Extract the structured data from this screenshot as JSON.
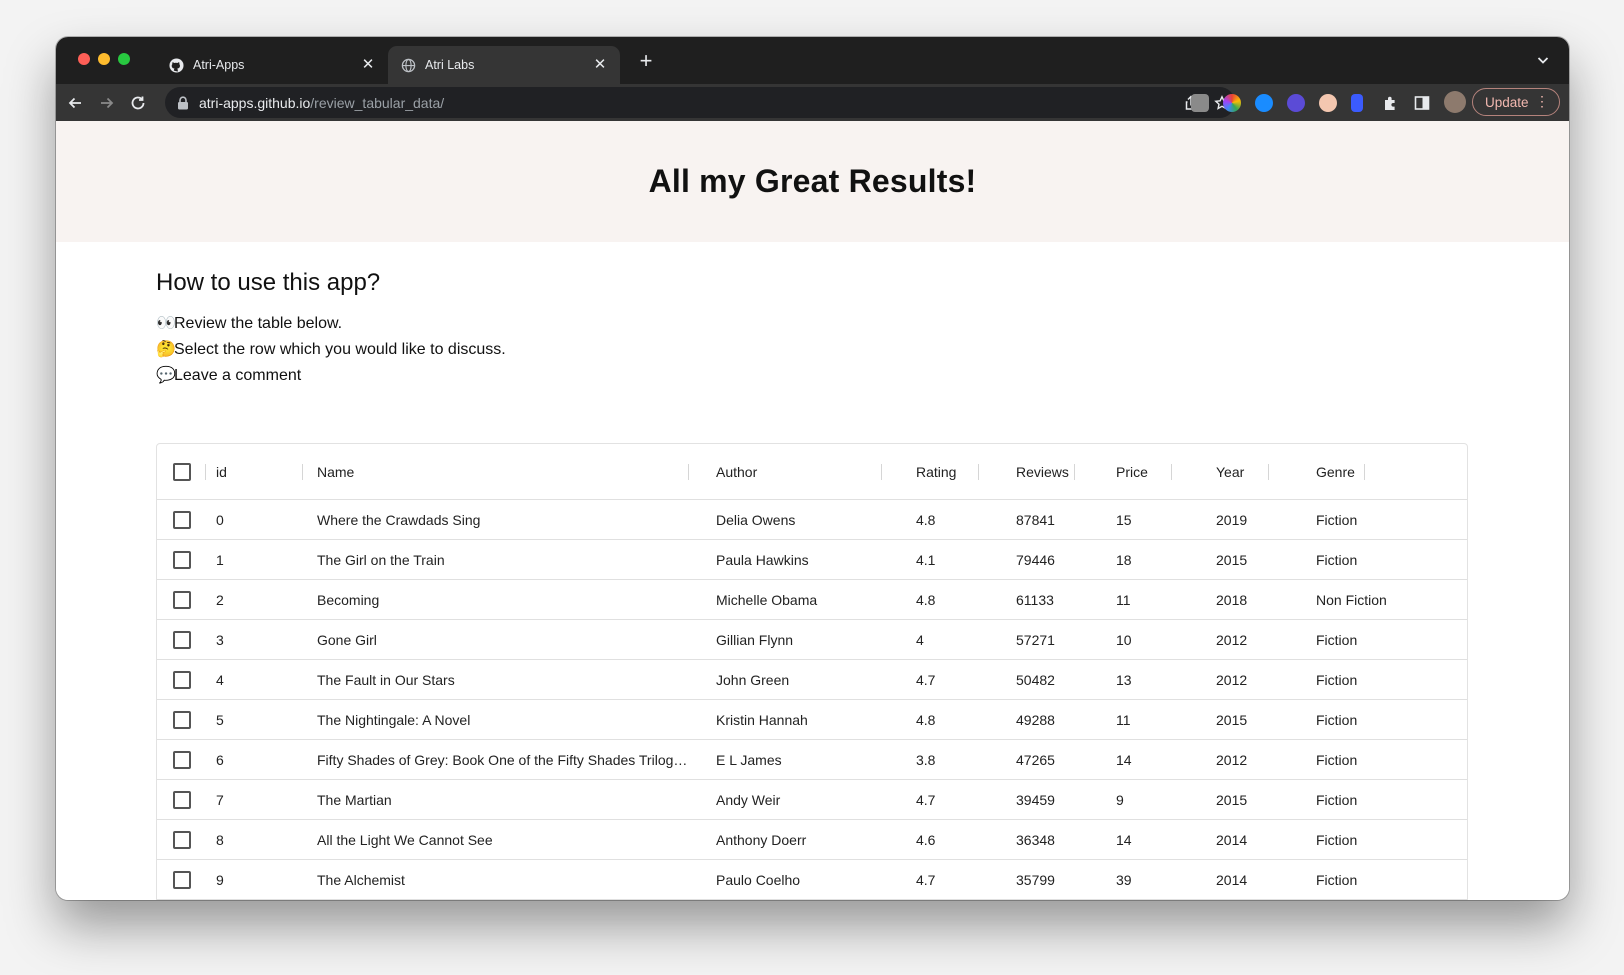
{
  "browser": {
    "tabs": [
      {
        "title": "Atri-Apps",
        "icon": "github-icon",
        "active": false
      },
      {
        "title": "Atri Labs",
        "icon": "globe-icon",
        "active": true
      }
    ],
    "url_host": "atri-apps.github.io",
    "url_path": "/review_tabular_data/",
    "update_label": "Update"
  },
  "page": {
    "title": "All my Great Results!",
    "howto_title": "How to use this app?",
    "steps": [
      {
        "emoji": "👀",
        "text": "Review the table below."
      },
      {
        "emoji": "🤔",
        "text": "Select the row which you would like to discuss."
      },
      {
        "emoji": "💬",
        "text": "Leave a comment"
      }
    ]
  },
  "table": {
    "columns": [
      "id",
      "Name",
      "Author",
      "Rating",
      "Reviews",
      "Price",
      "Year",
      "Genre"
    ],
    "rows": [
      [
        "0",
        "Where the Crawdads Sing",
        "Delia Owens",
        "4.8",
        "87841",
        "15",
        "2019",
        "Fiction"
      ],
      [
        "1",
        "The Girl on the Train",
        "Paula Hawkins",
        "4.1",
        "79446",
        "18",
        "2015",
        "Fiction"
      ],
      [
        "2",
        "Becoming",
        "Michelle Obama",
        "4.8",
        "61133",
        "11",
        "2018",
        "Non Fiction"
      ],
      [
        "3",
        "Gone Girl",
        "Gillian Flynn",
        "4",
        "57271",
        "10",
        "2012",
        "Fiction"
      ],
      [
        "4",
        "The Fault in Our Stars",
        "John Green",
        "4.7",
        "50482",
        "13",
        "2012",
        "Fiction"
      ],
      [
        "5",
        "The Nightingale: A Novel",
        "Kristin Hannah",
        "4.8",
        "49288",
        "11",
        "2015",
        "Fiction"
      ],
      [
        "6",
        "Fifty Shades of Grey: Book One of the Fifty Shades Trilog…",
        "E L James",
        "3.8",
        "47265",
        "14",
        "2012",
        "Fiction"
      ],
      [
        "7",
        "The Martian",
        "Andy Weir",
        "4.7",
        "39459",
        "9",
        "2015",
        "Fiction"
      ],
      [
        "8",
        "All the Light We Cannot See",
        "Anthony Doerr",
        "4.6",
        "36348",
        "14",
        "2014",
        "Fiction"
      ],
      [
        "9",
        "The Alchemist",
        "Paulo Coelho",
        "4.7",
        "35799",
        "39",
        "2014",
        "Fiction"
      ]
    ]
  }
}
